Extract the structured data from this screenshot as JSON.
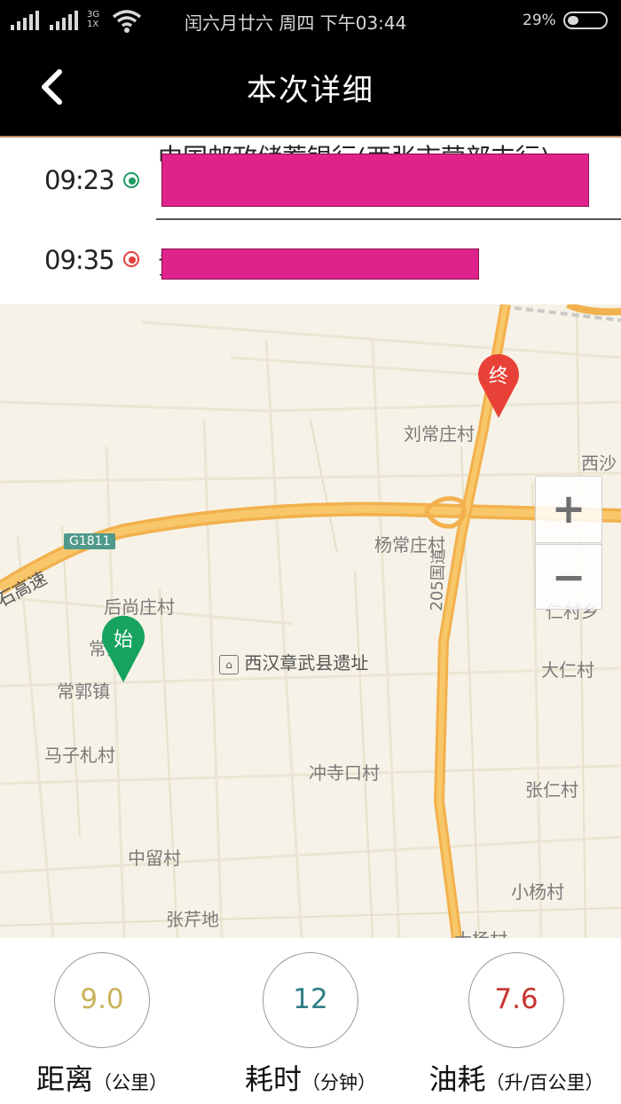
{
  "status_bar": {
    "network_top": "3G",
    "network_bottom": "1X",
    "date_time": "闰六月廿六  周四  下午03:44",
    "battery": "29%"
  },
  "header": {
    "title": "本次详细",
    "back_icon": "chevron-left-icon"
  },
  "route": {
    "start": {
      "time": "09:23",
      "text": "中国邮政储蓄银行(西张市营部支行)",
      "icon": "start-dot-icon",
      "color": "#1f9a63"
    },
    "end": {
      "time": "09:35",
      "text": "黄",
      "icon": "end-dot-icon",
      "color": "#e0403f"
    }
  },
  "map": {
    "places": {
      "liuchangzhuang": "刘常庄村",
      "xisha": "西沙",
      "yangchangzhuang": "杨常庄村",
      "g1811": "G1811",
      "gaosu": "石高速",
      "houshangzhuang": "后尚庄村",
      "changxiang": "常乡",
      "changguo": "常郭镇",
      "xihan": "西汉章武县遗址",
      "guodao": "205国道",
      "renxiang": "仁村乡",
      "daren": "大仁村",
      "mazizha": "马子札村",
      "chongsikou": "冲寺口村",
      "zhangren": "张仁村",
      "zhongliu": "中留村",
      "xiaoyang": "小杨村",
      "zhangqindi": "张芹地",
      "dayang": "大杨村"
    },
    "start_pin": "始",
    "end_pin": "终",
    "zoom_in": "+",
    "zoom_out": "−"
  },
  "stats": [
    {
      "value": "9.0",
      "label": "距离",
      "unit": "（公里）",
      "color": "#c9b25a"
    },
    {
      "value": "12",
      "label": "耗时",
      "unit": "（分钟）",
      "color": "#2f7d86"
    },
    {
      "value": "7.6",
      "label": "油耗",
      "unit": "（升/百公里）",
      "color": "#c8342f"
    }
  ]
}
